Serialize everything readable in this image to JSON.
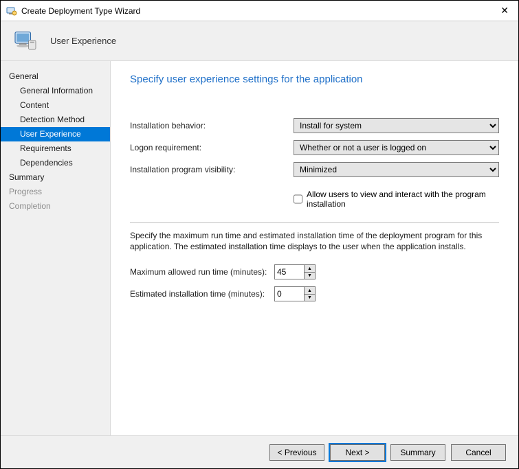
{
  "window": {
    "title": "Create Deployment Type Wizard"
  },
  "header": {
    "step_title": "User Experience"
  },
  "sidebar": {
    "items": [
      {
        "label": "General",
        "level": 0,
        "state": "normal"
      },
      {
        "label": "General Information",
        "level": 1,
        "state": "normal"
      },
      {
        "label": "Content",
        "level": 1,
        "state": "normal"
      },
      {
        "label": "Detection Method",
        "level": 1,
        "state": "normal"
      },
      {
        "label": "User Experience",
        "level": 1,
        "state": "selected"
      },
      {
        "label": "Requirements",
        "level": 1,
        "state": "normal"
      },
      {
        "label": "Dependencies",
        "level": 1,
        "state": "normal"
      },
      {
        "label": "Summary",
        "level": 0,
        "state": "normal"
      },
      {
        "label": "Progress",
        "level": 0,
        "state": "disabled"
      },
      {
        "label": "Completion",
        "level": 0,
        "state": "disabled"
      }
    ]
  },
  "main": {
    "heading": "Specify user experience settings for the application",
    "install_behavior": {
      "label": "Installation behavior:",
      "value": "Install for system"
    },
    "logon_requirement": {
      "label": "Logon requirement:",
      "value": "Whether or not a user is logged on"
    },
    "program_visibility": {
      "label": "Installation program visibility:",
      "value": "Minimized"
    },
    "allow_interaction": {
      "label": "Allow users to view and interact with the program installation",
      "checked": false
    },
    "time_description": "Specify the maximum run time and estimated installation time of the deployment program for this application. The estimated installation time displays to the user when the application installs.",
    "max_runtime": {
      "label": "Maximum allowed run time (minutes):",
      "value": "45"
    },
    "est_install": {
      "label": "Estimated installation time (minutes):",
      "value": "0"
    }
  },
  "footer": {
    "previous": "< Previous",
    "next": "Next >",
    "summary": "Summary",
    "cancel": "Cancel"
  }
}
